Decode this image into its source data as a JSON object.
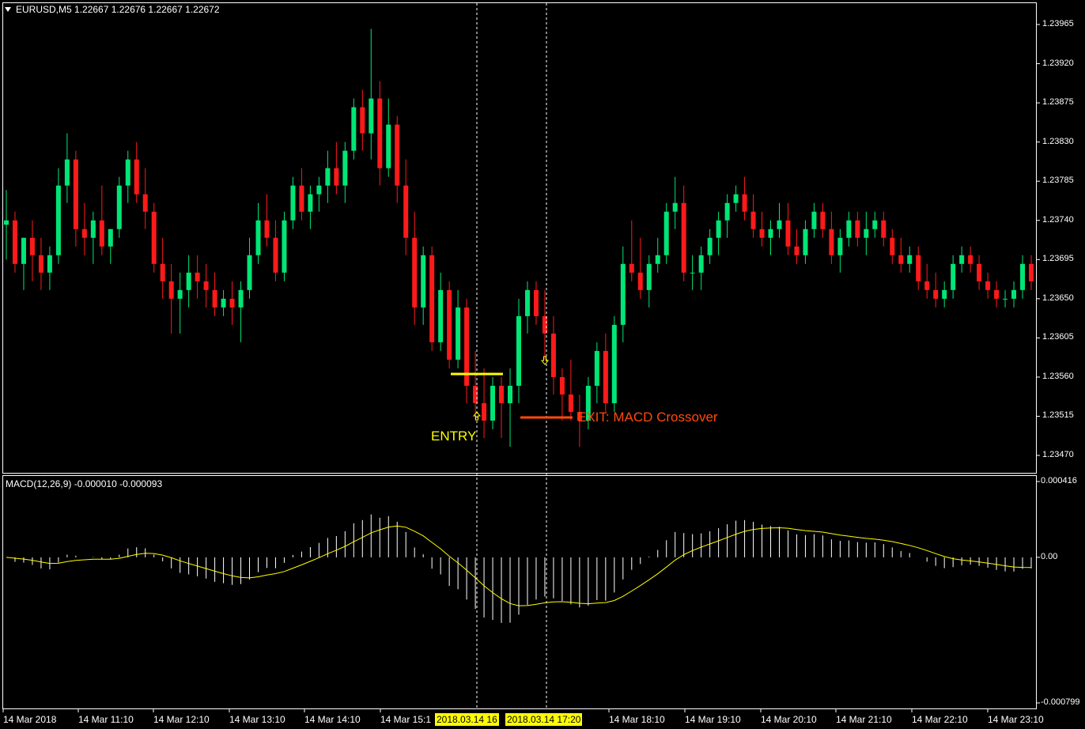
{
  "header": {
    "title": "EURUSD,M5  1.22667 1.22676 1.22667 1.22672",
    "macd_title": "MACD(12,26,9) -0.000010 -0.000093"
  },
  "annotations": {
    "entry": "ENTRY",
    "exit": "EXIT: MACD Crossover"
  },
  "highlighted_times": [
    "2018.03.14 16",
    "2018.03.14 17:20"
  ],
  "colors": {
    "background": "#000000",
    "bull": "#00e676",
    "bear": "#ff1a1a",
    "macd_hist": "#ffffff",
    "signal": "#ffff00",
    "entry": "#ffff00",
    "exit": "#ff4a0c",
    "frame": "#ffffff"
  },
  "chart_data": [
    {
      "type": "candlestick",
      "title": "EURUSD,M5",
      "symbol": "EURUSD",
      "timeframe": "M5",
      "last_ohlc": [
        1.22667,
        1.22676,
        1.22667,
        1.22672
      ],
      "ylim": [
        1.2344,
        1.2401
      ],
      "y_ticks": [
        "1.23965",
        "1.23920",
        "1.23875",
        "1.23830",
        "1.23785",
        "1.23740",
        "1.23695",
        "1.23650",
        "1.23605",
        "1.23560",
        "1.23515",
        "1.23470"
      ],
      "x_ticks": [
        "14 Mar 2018",
        "14 Mar 11:10",
        "14 Mar 12:10",
        "14 Mar 13:10",
        "14 Mar 14:10",
        "14 Mar 15:1",
        "14 Mar 18:10",
        "14 Mar 19:10",
        "14 Mar 20:10",
        "14 Mar 21:10",
        "14 Mar 22:10",
        "14 Mar 23:10"
      ],
      "candle_count": 163,
      "candles": [
        [
          1.23735,
          1.23775,
          1.23695,
          1.2374
        ],
        [
          1.2374,
          1.2375,
          1.2368,
          1.2369
        ],
        [
          1.2369,
          1.2372,
          1.2366,
          1.2372
        ],
        [
          1.2372,
          1.2374,
          1.2367,
          1.237
        ],
        [
          1.237,
          1.2372,
          1.2366,
          1.2368
        ],
        [
          1.2368,
          1.2371,
          1.2366,
          1.237
        ],
        [
          1.237,
          1.238,
          1.2369,
          1.2378
        ],
        [
          1.2378,
          1.2384,
          1.2376,
          1.2381
        ],
        [
          1.2381,
          1.2382,
          1.2371,
          1.2373
        ],
        [
          1.2373,
          1.2376,
          1.237,
          1.2372
        ],
        [
          1.2372,
          1.2375,
          1.2369,
          1.2374
        ],
        [
          1.2374,
          1.2378,
          1.237,
          1.2371
        ],
        [
          1.2371,
          1.2373,
          1.2369,
          1.2373
        ],
        [
          1.2373,
          1.2379,
          1.2372,
          1.2378
        ],
        [
          1.2378,
          1.2382,
          1.2376,
          1.2381
        ],
        [
          1.2381,
          1.2383,
          1.2376,
          1.2377
        ],
        [
          1.2377,
          1.238,
          1.2373,
          1.2375
        ],
        [
          1.2375,
          1.2376,
          1.2368,
          1.2369
        ],
        [
          1.2369,
          1.2372,
          1.2365,
          1.2367
        ],
        [
          1.2367,
          1.2369,
          1.2361,
          1.2365
        ],
        [
          1.2365,
          1.2368,
          1.2361,
          1.2366
        ],
        [
          1.2366,
          1.237,
          1.2364,
          1.2368
        ],
        [
          1.2368,
          1.237,
          1.2365,
          1.2367
        ],
        [
          1.2367,
          1.2369,
          1.2364,
          1.2366
        ],
        [
          1.2366,
          1.2368,
          1.2363,
          1.2364
        ],
        [
          1.2364,
          1.2366,
          1.2363,
          1.2365
        ],
        [
          1.2365,
          1.2367,
          1.2362,
          1.2364
        ],
        [
          1.2364,
          1.2367,
          1.236,
          1.2366
        ],
        [
          1.2366,
          1.2372,
          1.2365,
          1.237
        ],
        [
          1.237,
          1.2376,
          1.2369,
          1.2374
        ],
        [
          1.2374,
          1.2377,
          1.2371,
          1.2372
        ],
        [
          1.2372,
          1.2374,
          1.2367,
          1.2368
        ],
        [
          1.2368,
          1.2375,
          1.2367,
          1.2374
        ],
        [
          1.2374,
          1.2379,
          1.2373,
          1.2378
        ],
        [
          1.2378,
          1.238,
          1.2374,
          1.2375
        ],
        [
          1.2375,
          1.2378,
          1.2373,
          1.2377
        ],
        [
          1.2377,
          1.2379,
          1.2375,
          1.2378
        ],
        [
          1.2378,
          1.2382,
          1.2376,
          1.238
        ],
        [
          1.238,
          1.2383,
          1.2377,
          1.2378
        ],
        [
          1.2378,
          1.2383,
          1.2376,
          1.2382
        ],
        [
          1.2382,
          1.2388,
          1.2381,
          1.2387
        ],
        [
          1.2387,
          1.2389,
          1.2382,
          1.2384
        ],
        [
          1.2384,
          1.2396,
          1.2381,
          1.2388
        ],
        [
          1.2388,
          1.239,
          1.2378,
          1.238
        ],
        [
          1.238,
          1.2388,
          1.2379,
          1.2385
        ],
        [
          1.2385,
          1.2386,
          1.2376,
          1.2378
        ],
        [
          1.2378,
          1.2381,
          1.237,
          1.2372
        ],
        [
          1.2372,
          1.2375,
          1.2362,
          1.2364
        ],
        [
          1.2364,
          1.2371,
          1.2362,
          1.237
        ],
        [
          1.237,
          1.2371,
          1.2359,
          1.236
        ],
        [
          1.236,
          1.2368,
          1.2359,
          1.2366
        ],
        [
          1.2366,
          1.2367,
          1.2357,
          1.2358
        ],
        [
          1.2358,
          1.2366,
          1.2357,
          1.2364
        ],
        [
          1.2364,
          1.2365,
          1.2353,
          1.2355
        ],
        [
          1.2355,
          1.2359,
          1.2351,
          1.2353
        ],
        [
          1.2353,
          1.2357,
          1.2349,
          1.2351
        ],
        [
          1.2351,
          1.2356,
          1.235,
          1.2355
        ],
        [
          1.2355,
          1.2356,
          1.2349,
          1.2353
        ],
        [
          1.2353,
          1.2357,
          1.2348,
          1.2355
        ],
        [
          1.2355,
          1.2365,
          1.2353,
          1.2363
        ],
        [
          1.2363,
          1.2367,
          1.2361,
          1.2366
        ],
        [
          1.2366,
          1.2367,
          1.2362,
          1.2363
        ],
        [
          1.2363,
          1.2366,
          1.2358,
          1.2361
        ],
        [
          1.2361,
          1.2363,
          1.2354,
          1.2356
        ],
        [
          1.2356,
          1.2357,
          1.2351,
          1.2354
        ],
        [
          1.2354,
          1.2358,
          1.2351,
          1.2352
        ],
        [
          1.2352,
          1.2354,
          1.2348,
          1.2351
        ],
        [
          1.2351,
          1.2356,
          1.235,
          1.2355
        ],
        [
          1.2355,
          1.236,
          1.2353,
          1.2359
        ],
        [
          1.2359,
          1.2361,
          1.2352,
          1.2353
        ],
        [
          1.2353,
          1.2363,
          1.2352,
          1.2362
        ],
        [
          1.2362,
          1.2371,
          1.236,
          1.2369
        ],
        [
          1.2369,
          1.2374,
          1.2367,
          1.2368
        ],
        [
          1.2368,
          1.2372,
          1.2365,
          1.2366
        ],
        [
          1.2366,
          1.237,
          1.2364,
          1.2369
        ],
        [
          1.2369,
          1.2372,
          1.2368,
          1.237
        ],
        [
          1.237,
          1.2376,
          1.2369,
          1.2375
        ],
        [
          1.2375,
          1.2379,
          1.2373,
          1.2376
        ],
        [
          1.2376,
          1.2378,
          1.2367,
          1.2368
        ],
        [
          1.2368,
          1.237,
          1.2366,
          1.2368
        ],
        [
          1.2368,
          1.2371,
          1.2366,
          1.237
        ],
        [
          1.237,
          1.2373,
          1.2369,
          1.2372
        ],
        [
          1.2372,
          1.2375,
          1.237,
          1.2374
        ],
        [
          1.2374,
          1.2377,
          1.2372,
          1.2376
        ],
        [
          1.2376,
          1.2378,
          1.2375,
          1.2377
        ],
        [
          1.2377,
          1.2379,
          1.2374,
          1.2375
        ],
        [
          1.2375,
          1.2377,
          1.2372,
          1.2373
        ],
        [
          1.2373,
          1.2375,
          1.2371,
          1.2372
        ],
        [
          1.2372,
          1.2374,
          1.237,
          1.2373
        ],
        [
          1.2373,
          1.2376,
          1.2372,
          1.2374
        ],
        [
          1.2374,
          1.2376,
          1.237,
          1.2371
        ],
        [
          1.2371,
          1.2373,
          1.2369,
          1.237
        ],
        [
          1.237,
          1.2374,
          1.2369,
          1.2373
        ],
        [
          1.2373,
          1.2376,
          1.2372,
          1.2375
        ],
        [
          1.2375,
          1.2376,
          1.2372,
          1.2373
        ],
        [
          1.2373,
          1.2375,
          1.2369,
          1.237
        ],
        [
          1.237,
          1.2373,
          1.2368,
          1.2372
        ],
        [
          1.2372,
          1.2375,
          1.2371,
          1.2374
        ],
        [
          1.2374,
          1.2375,
          1.2371,
          1.2372
        ],
        [
          1.2372,
          1.2375,
          1.237,
          1.2373
        ],
        [
          1.2373,
          1.2375,
          1.2372,
          1.2374
        ],
        [
          1.2374,
          1.2375,
          1.2371,
          1.2372
        ],
        [
          1.2372,
          1.2373,
          1.2369,
          1.237
        ],
        [
          1.237,
          1.2372,
          1.2368,
          1.2369
        ],
        [
          1.2369,
          1.2371,
          1.2368,
          1.237
        ],
        [
          1.237,
          1.2371,
          1.2366,
          1.2367
        ],
        [
          1.2367,
          1.2369,
          1.2365,
          1.2366
        ],
        [
          1.2366,
          1.2368,
          1.2364,
          1.2365
        ],
        [
          1.2365,
          1.2367,
          1.2364,
          1.2366
        ],
        [
          1.2366,
          1.237,
          1.2365,
          1.2369
        ],
        [
          1.2369,
          1.2371,
          1.2368,
          1.237
        ],
        [
          1.237,
          1.2371,
          1.2368,
          1.2369
        ],
        [
          1.2369,
          1.237,
          1.2366,
          1.2367
        ],
        [
          1.2367,
          1.2368,
          1.2365,
          1.2366
        ],
        [
          1.2366,
          1.2367,
          1.2364,
          1.2365
        ],
        [
          1.2365,
          1.2366,
          1.2364,
          1.2365
        ],
        [
          1.2365,
          1.2367,
          1.2364,
          1.2366
        ],
        [
          1.2366,
          1.237,
          1.2365,
          1.2369
        ],
        [
          1.2369,
          1.237,
          1.2366,
          1.2367
        ]
      ]
    },
    {
      "type": "bar",
      "title": "MACD(12,26,9)",
      "series": [
        {
          "name": "MACD",
          "last": -1e-05
        },
        {
          "name": "Signal",
          "last": -9.3e-05
        }
      ],
      "y_ticks": [
        "0.000416",
        "0.00",
        "-0.000799"
      ],
      "ylim": [
        -0.000799,
        0.000416
      ]
    }
  ]
}
